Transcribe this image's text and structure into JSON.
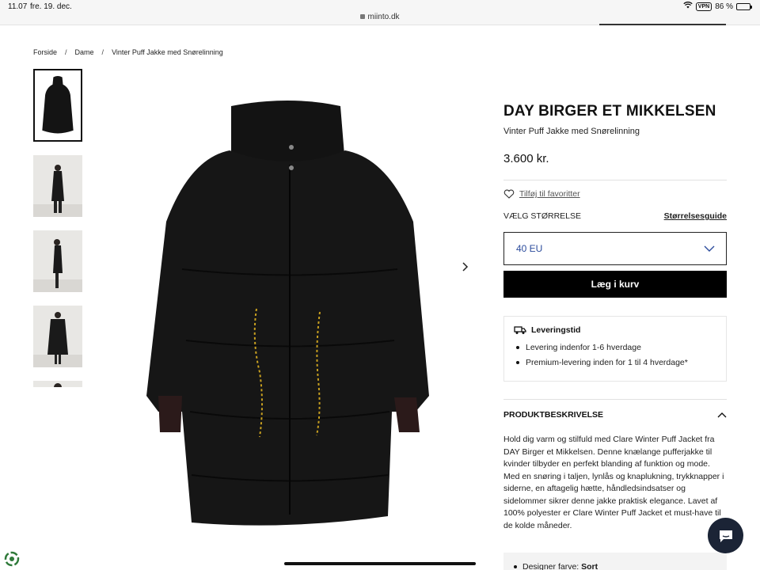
{
  "status_bar": {
    "time": "11.07",
    "date": "fre. 19. dec.",
    "vpn_label": "VPN",
    "battery": "86 %"
  },
  "browser": {
    "url": "miinto.dk"
  },
  "breadcrumb": {
    "items": [
      "Forside",
      "Dame",
      "Vinter Puff Jakke med Snørelinning"
    ],
    "separator": "/"
  },
  "gallery": {
    "thumbnail_count": 5,
    "active_index": 0
  },
  "product": {
    "brand": "DAY BIRGER ET MIKKELSEN",
    "name": "Vinter Puff Jakke med Snørelinning",
    "price": "3.600 kr.",
    "favorite_label": "Tilføj til favoritter",
    "size_label": "VÆLG STØRRELSE",
    "size_guide_label": "Størrelsesguide",
    "selected_size": "40 EU",
    "add_to_cart_label": "Læg i kurv"
  },
  "delivery": {
    "title": "Leveringstid",
    "items": [
      "Levering indenfor 1-6 hverdage",
      "Premium-levering inden for 1 til 4 hverdage*"
    ]
  },
  "description": {
    "header": "PRODUKTBESKRIVELSE",
    "text": "Hold dig varm og stilfuld med Clare Winter Puff Jacket fra DAY Birger et Mikkelsen. Denne knælange pufferjakke til kvinder tilbyder en perfekt blanding af funktion og mode. Med en snøring i taljen, lynlås og knaplukning, trykknapper i siderne, en aftagelig hætte, håndledsindsatser og sidelommer sikrer denne jakke praktisk elegance. Lavet af 100% polyester er Clare Winter Puff Jacket et must-have til de kolde måneder.",
    "details_label": "Designer farve:",
    "details_value": "Sort"
  },
  "colors": {
    "accent_text": "#2c4c9c",
    "button_bg": "#000000",
    "chat_bg": "#1b2436"
  }
}
